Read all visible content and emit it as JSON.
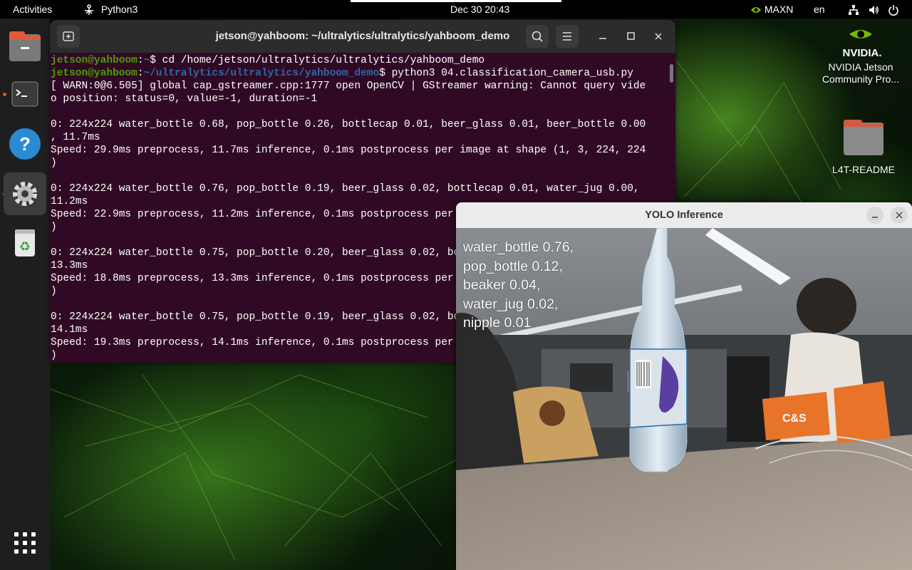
{
  "topbar": {
    "activities": "Activities",
    "app_name": "Python3",
    "datetime": "Dec 30  20:43",
    "power_mode": "MAXN",
    "language": "en"
  },
  "dock": {
    "items": [
      "Files",
      "Terminal",
      "Help",
      "Settings",
      "Trash",
      "Show Applications"
    ]
  },
  "terminal": {
    "title": "jetson@yahboom: ~/ultralytics/ultralytics/yahboom_demo",
    "prompt1_user": "jetson@yahboom",
    "prompt1_path": "~",
    "prompt1_cmd": "$ cd /home/jetson/ultralytics/ultralytics/yahboom_demo",
    "prompt2_user": "jetson@yahboom",
    "prompt2_path": "~/ultralytics/ultralytics/yahboom_demo",
    "prompt2_cmd": "$ python3 04.classification_camera_usb.py",
    "lines": [
      "[ WARN:0@6.505] global cap_gstreamer.cpp:1777 open OpenCV | GStreamer warning: Cannot query vide",
      "o position: status=0, value=-1, duration=-1",
      "",
      "0: 224x224 water_bottle 0.68, pop_bottle 0.26, bottlecap 0.01, beer_glass 0.01, beer_bottle 0.00",
      ", 11.7ms",
      "Speed: 29.9ms preprocess, 11.7ms inference, 0.1ms postprocess per image at shape (1, 3, 224, 224",
      ")",
      "",
      "0: 224x224 water_bottle 0.76, pop_bottle 0.19, beer_glass 0.02, bottlecap 0.01, water_jug 0.00,",
      "11.2ms",
      "Speed: 22.9ms preprocess, 11.2ms inference, 0.1ms postprocess per image at shape (1, 3, 224, 224",
      ")",
      "",
      "0: 224x224 water_bottle 0.75, pop_bottle 0.20, beer_glass 0.02, bottlecap 0.01, water_jug 0.00,",
      "13.3ms",
      "Speed: 18.8ms preprocess, 13.3ms inference, 0.1ms postprocess per image at shape (1, 3, 224, 224",
      ")",
      "",
      "0: 224x224 water_bottle 0.75, pop_bottle 0.19, beer_glass 0.02, bottlecap 0.01, water_jug 0.00,",
      "14.1ms",
      "Speed: 19.3ms preprocess, 14.1ms inference, 0.1ms postprocess per image at shape (1, 3, 224, 224",
      ")"
    ]
  },
  "yolo": {
    "title": "YOLO Inference",
    "predictions": [
      "water_bottle 0.76,",
      "pop_bottle 0.12,",
      "beaker 0.04,",
      "water_jug 0.02,",
      "nipple 0.01"
    ],
    "bottle_label": "C&S"
  },
  "desktop": {
    "nvidia_brand": "NVIDIA.",
    "nvidia_label": "NVIDIA Jetson Community Pro...",
    "readme_label": "L4T-README"
  },
  "colors": {
    "terminal_bg": "#300a24",
    "prompt_user": "#4e9a06",
    "prompt_path": "#3465a4",
    "accent": "#e95420",
    "nvidia_green": "#76b900"
  }
}
